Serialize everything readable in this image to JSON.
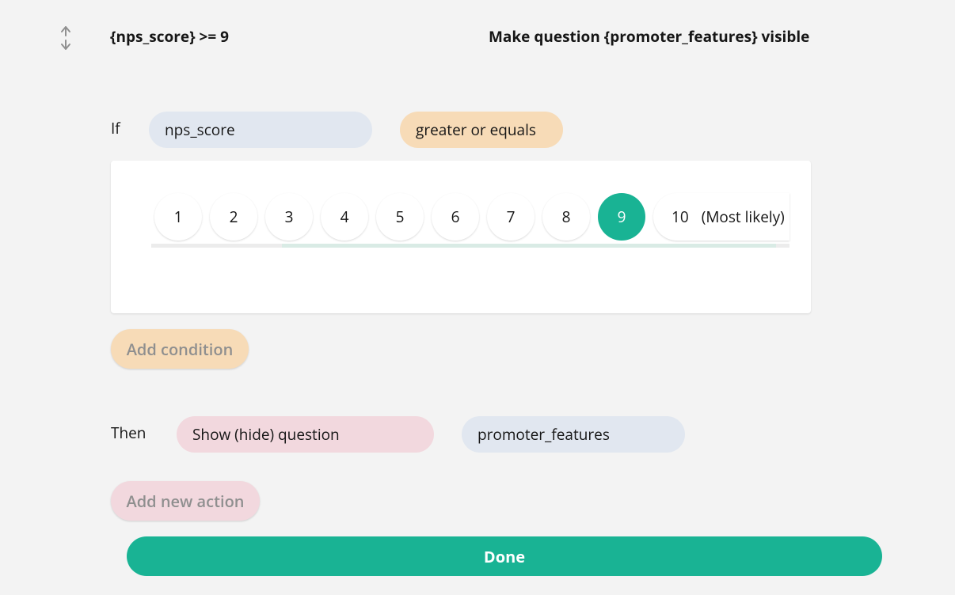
{
  "header": {
    "condition_summary": "{nps_score} >= 9",
    "action_summary": "Make question {promoter_features} visible",
    "drag_icon": "reorder-arrows-icon"
  },
  "condition": {
    "label": "If",
    "question": "nps_score",
    "operator": "greater or equals",
    "rating": {
      "items": [
        "1",
        "2",
        "3",
        "4",
        "5",
        "6",
        "7",
        "8",
        "9",
        "10"
      ],
      "selected": "9",
      "max_label": "(Most likely)"
    },
    "add_condition_label": "Add condition"
  },
  "action": {
    "label": "Then",
    "type": "Show (hide) question",
    "target": "promoter_features",
    "add_action_label": "Add new action"
  },
  "done_label": "Done",
  "colors": {
    "accent": "#19b394",
    "question_pill": "#e1e7f0",
    "operator_pill": "#f7dbb7",
    "action_pill": "#f2d8de"
  }
}
